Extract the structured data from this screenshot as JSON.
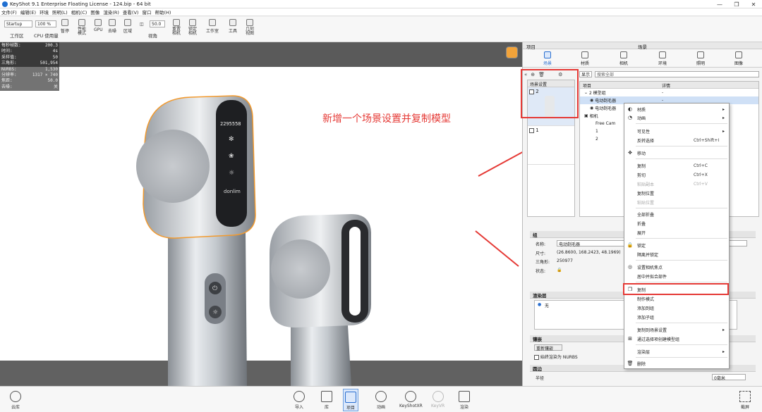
{
  "window": {
    "title": "KeyShot 9.1 Enterprise Floating License  -  124.bip  -  64 bit"
  },
  "menu": [
    "文件(F)",
    "编辑(E)",
    "环境",
    "照明(L)",
    "相机(C)",
    "图像",
    "渲染(R)",
    "查看(V)",
    "窗口",
    "帮助(H)"
  ],
  "toolbar": {
    "workspace_value": "Startup",
    "cpu_value": "100 %",
    "fov_value": "50.0",
    "labels": {
      "workspace": "工作区",
      "cpu": "CPU 使用量",
      "pause": "暂停",
      "perf": "性能\n模式",
      "gpu": "GPU",
      "denoise": "去噪",
      "region": "区域",
      "view": "视角",
      "reset_cam": "重置\n相机",
      "lock_cam": "锁定\n相机",
      "studio": "工作室",
      "tools": "工具",
      "geo_view": "几何\n视图"
    }
  },
  "stats": [
    {
      "k": "每秒帧数:",
      "v": "200.3"
    },
    {
      "k": "时间:",
      "v": "4s"
    },
    {
      "k": "采样值:",
      "v": "50"
    },
    {
      "k": "三角形:",
      "v": "501,954"
    },
    {
      "k": "NURBS:",
      "v": "1,530"
    },
    {
      "k": "分辨率:",
      "v": "1317 × 740"
    },
    {
      "k": "焦距:",
      "v": "50.0"
    },
    {
      "k": "去噪:",
      "v": "关"
    }
  ],
  "annotation": "新增一个场景设置并复制模型",
  "panel": {
    "project_label": "项目",
    "scene_label": "场景",
    "tabs": [
      "场景",
      "材质",
      "相机",
      "环境",
      "照明",
      "图像"
    ],
    "env_header": "场景设置",
    "env_items": [
      "2",
      "1"
    ],
    "display_label": "显示",
    "search_placeholder": "搜索全部",
    "tree_header": {
      "item": "项目",
      "detail": "详情"
    },
    "tree": [
      {
        "label": "2 模型组",
        "detail": "-"
      },
      {
        "label": "电动剃毛器",
        "detail": "-"
      },
      {
        "label": "电动剃毛器",
        "detail": ""
      },
      {
        "label": "相机",
        "detail": ""
      },
      {
        "label": "Free Cam",
        "detail": ""
      },
      {
        "label": "1",
        "detail": ""
      },
      {
        "label": "2",
        "detail": ""
      }
    ]
  },
  "props": {
    "group_title": "组",
    "name_label": "名称:",
    "name_value": "电动剃毛器",
    "size_label": "尺寸:",
    "size_value": "(26.8600, 168.2423, 48.1969)",
    "tri_label": "三角形:",
    "tri_value": "250977",
    "state_label": "状态:",
    "render_layer_title": "渲染层",
    "render_layer_value": "无",
    "mirror_title": "镶嵌",
    "retessellate": "重新镶嵌",
    "nurbs_check": "始终渲染为 NURBS",
    "round_title": "圆边",
    "radius_label": "半径",
    "radius_value": "0毫米"
  },
  "context_menu": [
    {
      "label": "材质",
      "shortcut": "",
      "arrow": true,
      "icon": "material-icon",
      "disabled": false
    },
    {
      "label": "动画",
      "shortcut": "",
      "arrow": true,
      "icon": "animation-icon",
      "disabled": false
    },
    {
      "label": "可见性",
      "shortcut": "",
      "arrow": true,
      "icon": "",
      "disabled": false
    },
    {
      "label": "反转选择",
      "shortcut": "Ctrl+Shift+I",
      "arrow": false,
      "icon": "",
      "disabled": false
    },
    {
      "label": "移动",
      "shortcut": "",
      "arrow": false,
      "icon": "move-icon",
      "disabled": false
    },
    {
      "label": "复制",
      "shortcut": "Ctrl+C",
      "arrow": false,
      "icon": "",
      "disabled": false
    },
    {
      "label": "剪切",
      "shortcut": "Ctrl+X",
      "arrow": false,
      "icon": "",
      "disabled": false
    },
    {
      "label": "粘贴副本",
      "shortcut": "Ctrl+V",
      "arrow": false,
      "icon": "",
      "disabled": true
    },
    {
      "label": "复制位置",
      "shortcut": "",
      "arrow": false,
      "icon": "",
      "disabled": false
    },
    {
      "label": "粘贴位置",
      "shortcut": "",
      "arrow": false,
      "icon": "",
      "disabled": true
    },
    {
      "label": "全部折叠",
      "shortcut": "",
      "arrow": false,
      "icon": "",
      "disabled": false
    },
    {
      "label": "折叠",
      "shortcut": "",
      "arrow": false,
      "icon": "",
      "disabled": false
    },
    {
      "label": "展开",
      "shortcut": "",
      "arrow": false,
      "icon": "",
      "disabled": false
    },
    {
      "label": "锁定",
      "shortcut": "",
      "arrow": false,
      "icon": "lock-icon",
      "disabled": false
    },
    {
      "label": "隔离并锁定",
      "shortcut": "",
      "arrow": false,
      "icon": "",
      "disabled": false
    },
    {
      "label": "设置相机焦点",
      "shortcut": "",
      "arrow": false,
      "icon": "focus-icon",
      "disabled": false
    },
    {
      "label": "居中并拟合部件",
      "shortcut": "",
      "arrow": false,
      "icon": "",
      "disabled": false
    },
    {
      "label": "复制",
      "shortcut": "",
      "arrow": false,
      "icon": "duplicate-icon",
      "disabled": false
    },
    {
      "label": "制作模式",
      "shortcut": "",
      "arrow": false,
      "icon": "",
      "disabled": false
    },
    {
      "label": "添加到组",
      "shortcut": "",
      "arrow": false,
      "icon": "",
      "disabled": false
    },
    {
      "label": "添加子组",
      "shortcut": "",
      "arrow": false,
      "icon": "",
      "disabled": false
    },
    {
      "label": "复制到场景设置",
      "shortcut": "",
      "arrow": true,
      "icon": "",
      "disabled": false
    },
    {
      "label": "通过选择项创建模型组",
      "shortcut": "",
      "arrow": false,
      "icon": "group-icon",
      "disabled": false
    },
    {
      "label": "渲染层",
      "shortcut": "",
      "arrow": true,
      "icon": "",
      "disabled": false
    },
    {
      "label": "删除",
      "shortcut": "",
      "arrow": false,
      "icon": "trash-icon",
      "disabled": false
    }
  ],
  "bottom": {
    "cloud": "云库",
    "tabs": [
      "导入",
      "库",
      "项目",
      "动画",
      "KeyShotXR",
      "KeyVR",
      "渲染"
    ],
    "fullscreen": "截屏"
  },
  "device": {
    "screen_text": "2295558",
    "brand": "donlim"
  },
  "colors": {
    "annotation": "#e53935",
    "accent": "#2a6fd0",
    "orange_outline": "#f29a2e"
  }
}
